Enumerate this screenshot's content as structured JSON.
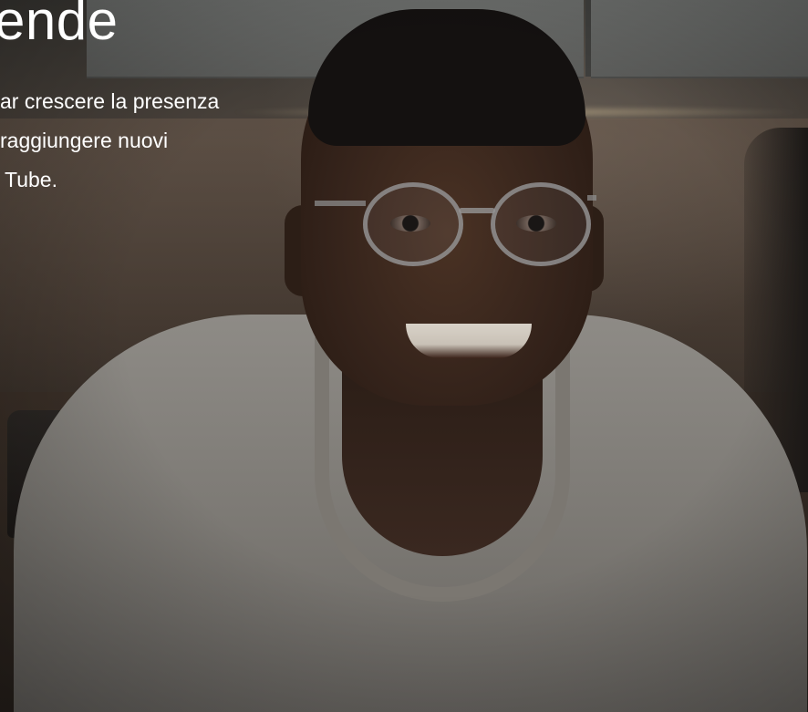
{
  "hero": {
    "headline": "ende",
    "body_lines": [
      "ar crescere la presenza",
      "raggiungere nuovi",
      "Tube."
    ]
  },
  "colors": {
    "text": "#ffffff",
    "overlay": "#2b2724",
    "shirt": "#8e8b86"
  }
}
